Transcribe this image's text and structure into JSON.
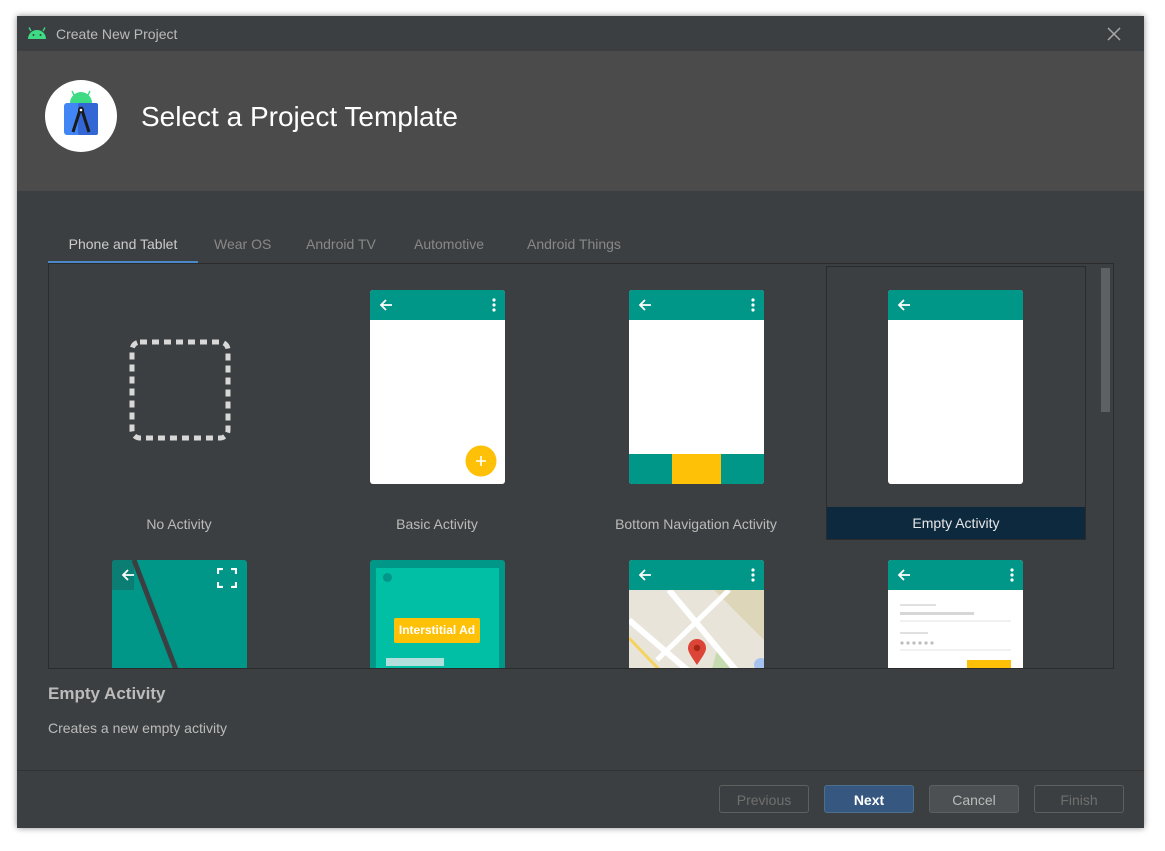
{
  "window": {
    "title": "Create New Project"
  },
  "header": {
    "title": "Select a Project Template"
  },
  "tabs": [
    {
      "label": "Phone and Tablet",
      "active": true
    },
    {
      "label": "Wear OS",
      "active": false
    },
    {
      "label": "Android TV",
      "active": false
    },
    {
      "label": "Automotive",
      "active": false
    },
    {
      "label": "Android Things",
      "active": false
    }
  ],
  "templates": [
    {
      "label": "No Activity",
      "selected": false
    },
    {
      "label": "Basic Activity",
      "selected": false
    },
    {
      "label": "Bottom Navigation Activity",
      "selected": false
    },
    {
      "label": "Empty Activity",
      "selected": true
    },
    {
      "label": "",
      "selected": false
    },
    {
      "label": "",
      "selected": false,
      "badge": "Interstitial Ad"
    },
    {
      "label": "",
      "selected": false
    },
    {
      "label": "",
      "selected": false
    }
  ],
  "description": {
    "title": "Empty Activity",
    "text": "Creates a new empty activity"
  },
  "buttons": {
    "previous": "Previous",
    "next": "Next",
    "cancel": "Cancel",
    "finish": "Finish"
  },
  "colors": {
    "accent": "#009688",
    "fab": "#ffc107",
    "selection": "#0d293e",
    "primary_button": "#365880"
  }
}
